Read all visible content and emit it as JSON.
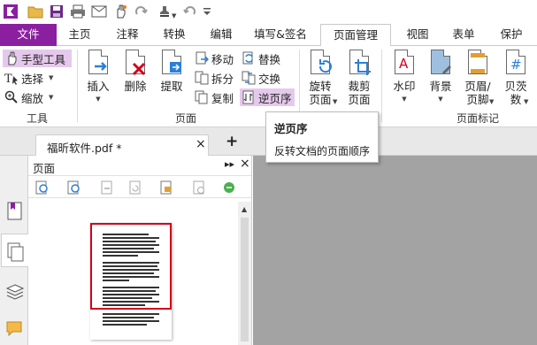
{
  "colors": {
    "accent": "#8a1fa0",
    "selected": "#e5c9ec",
    "thumb_border": "#d0021b",
    "canvas": "#a3a3a3"
  },
  "qat": {
    "icons": [
      "foxit-logo-icon",
      "open-folder-icon",
      "save-icon",
      "print-icon",
      "email-icon",
      "hand-icon",
      "redo-icon",
      "stamp-icon",
      "undo-icon",
      "customize-icon"
    ]
  },
  "tabs": {
    "file": "文件",
    "home": "主页",
    "annotate": "注释",
    "convert": "转换",
    "edit": "编辑",
    "fill_sign": "填写&签名",
    "page_manage": "页面管理",
    "view": "视图",
    "form": "表单",
    "protect": "保护"
  },
  "ribbon": {
    "tools": {
      "hand": "手型工具",
      "select": "选择",
      "zoom": "缩放",
      "label": "工具"
    },
    "pages": {
      "insert": "插入",
      "delete": "删除",
      "extract": "提取",
      "move": "移动",
      "split": "拆分",
      "copy": "复制",
      "replace": "替换",
      "swap": "交换",
      "reverse": "逆页序",
      "label": "页面"
    },
    "rotate": {
      "line1": "旋转",
      "line2": "页面"
    },
    "crop": {
      "line1": "裁剪",
      "line2": "页面"
    },
    "marks": {
      "watermark": "水印",
      "background": "背景",
      "header_line1": "页眉/",
      "header_line2": "页脚",
      "bates_line1": "贝茨",
      "bates_line2": "数",
      "label": "页面标记"
    }
  },
  "tooltip": {
    "title": "逆页序",
    "desc": "反转文档的页面顺序"
  },
  "doc_tab": {
    "name": "福昕软件.pdf *",
    "close": "×",
    "add": "+"
  },
  "panel": {
    "title": "页面",
    "expand": "▸▸",
    "close": "×"
  }
}
